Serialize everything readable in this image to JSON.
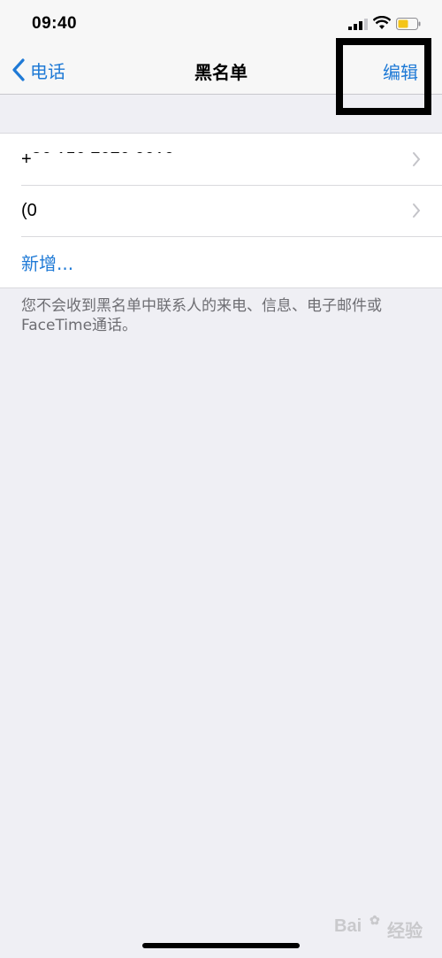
{
  "status_bar": {
    "time": "09:40",
    "signal_icon": "cellular-signal-icon",
    "wifi_icon": "wifi-icon",
    "battery_icon": "battery-icon",
    "battery_color": "#f5c518"
  },
  "nav": {
    "back_label": "电话",
    "title": "黑名单",
    "edit_label": "编辑"
  },
  "blocked_list": {
    "items": [
      {
        "label": "+86 150 7070 0010"
      },
      {
        "label": "(0"
      }
    ],
    "add_label": "新增..."
  },
  "footer_note": "您不会收到黑名单中联系人的来电、信息、电子邮件或FaceTime通话。",
  "watermark": "Bai 经验",
  "colors": {
    "accent": "#1f7ad6",
    "background": "#efeff4"
  }
}
